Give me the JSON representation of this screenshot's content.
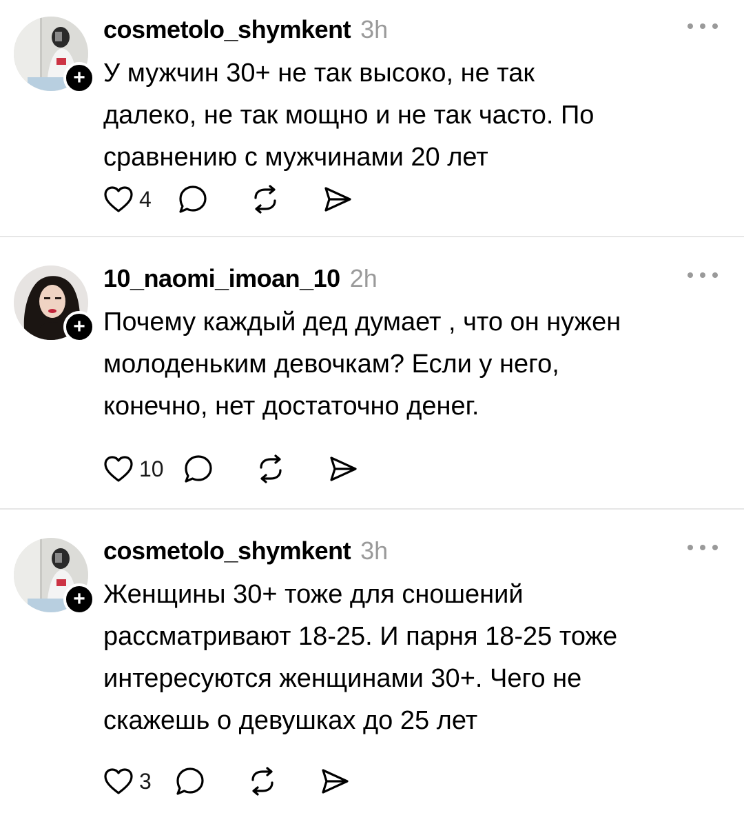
{
  "posts": [
    {
      "username": "cosmetolo_shymkent",
      "time": "3h",
      "text": "У мужчин 30+ не так высоко, не так\nдалеко, не так мощно и не так часто. По\nсравнению с мужчинами 20 лет",
      "likes": "4",
      "avatar_icon": "avatar-light-mirror-selfie"
    },
    {
      "username": "10_naomi_imoan_10",
      "time": "2h",
      "text": "Почему каждый дед думает , что он нужен\nмолоденьким девочкам? Если у него,\nконечно, нет достаточно денег.",
      "likes": "10",
      "avatar_icon": "avatar-dark-hair-portrait"
    },
    {
      "username": "cosmetolo_shymkent",
      "time": "3h",
      "text": "Женщины 30+ тоже для сношений\nрассматривают 18-25. И парня 18-25 тоже\nинтересуются женщинами 30+. Чего не\nскажешь о девушках до 25 лет",
      "likes": "3",
      "avatar_icon": "avatar-light-mirror-selfie"
    }
  ],
  "icons": {
    "like": "heart-icon",
    "reply": "comment-bubble-icon",
    "repost": "repost-icon",
    "share": "send-icon",
    "more": "more-dots-icon",
    "follow": "plus-icon"
  }
}
